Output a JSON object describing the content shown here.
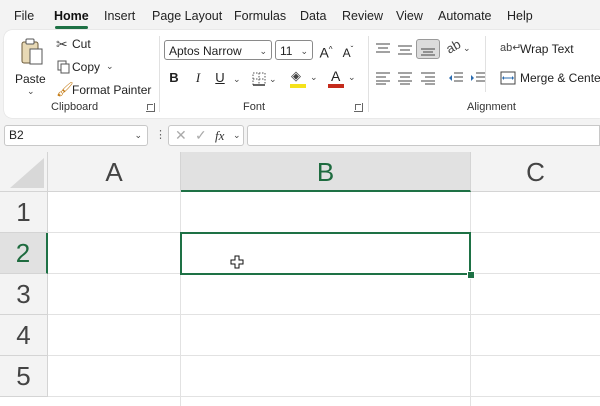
{
  "menu": {
    "items": [
      "File",
      "Home",
      "Insert",
      "Page Layout",
      "Formulas",
      "Data",
      "Review",
      "View",
      "Automate",
      "Help"
    ],
    "active": "Home"
  },
  "clipboard": {
    "paste_label": "Paste",
    "cut_label": "Cut",
    "copy_label": "Copy",
    "format_painter_label": "Format Painter",
    "group_label": "Clipboard"
  },
  "font": {
    "font_name": "Aptos Narrow",
    "font_size": "11",
    "bold": "B",
    "italic": "I",
    "underline": "U",
    "group_label": "Font",
    "highlight_color": "#f5e21b",
    "font_color": "#c42b1c"
  },
  "alignment": {
    "wrap_text_label": "Wrap Text",
    "merge_center_label": "Merge & Center",
    "group_label": "Alignment"
  },
  "formula_bar": {
    "name_box": "B2",
    "fx": "fx",
    "formula": ""
  },
  "sheet": {
    "columns": [
      "A",
      "B",
      "C"
    ],
    "rows": [
      "1",
      "2",
      "3",
      "4",
      "5"
    ],
    "selected_cell": "B2",
    "accent_color": "#1e7145"
  }
}
